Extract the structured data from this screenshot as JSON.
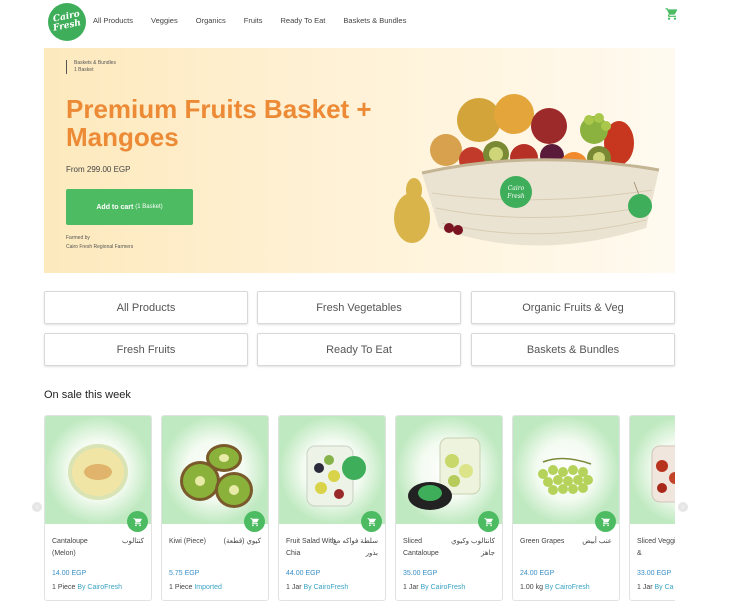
{
  "header": {
    "logo_line1": "Cairo",
    "logo_line2": "Fresh",
    "nav": [
      "All Products",
      "Veggies",
      "Organics",
      "Fruits",
      "Ready To Eat",
      "Baskets & Bundles"
    ]
  },
  "hero": {
    "breadcrumb_category": "Baskets & Bundles",
    "breadcrumb_count": "1 Basket",
    "title": "Premium Fruits Basket + Mangoes",
    "price_from": "From 299.00 EGP",
    "add_to_cart": "Add to cart",
    "add_to_cart_qty": "(1 Basket)",
    "farmed_by_label": "Farmed by",
    "farmed_by_value": "Cairo Fresh Regional Farmers",
    "tag_text": "Cairo Fresh"
  },
  "categories": [
    "All Products",
    "Fresh Vegetables",
    "Organic Fruits & Veg",
    "Fresh Fruits",
    "Ready To Eat",
    "Baskets & Bundles"
  ],
  "sale_section_title": "On sale this week",
  "products": [
    {
      "name_en": "Cantaloupe (Melon)",
      "name_ar": "كنتالوب",
      "price": "14.00 EGP",
      "unit": "1 Piece",
      "source": "By CairoFresh"
    },
    {
      "name_en": "Kiwi (Piece)",
      "name_ar": "كيوي (قطعة)",
      "price": "5.75 EGP",
      "unit": "1 Piece",
      "source": "Imported"
    },
    {
      "name_en": "Fruit Salad With Chia",
      "name_ar": "سلطة فواكه مع بذور",
      "price": "44.00 EGP",
      "unit": "1 Jar",
      "source": "By CairoFresh"
    },
    {
      "name_en": "Sliced Cantaloupe",
      "name_ar": "كانتالوب وكيوي جاهز",
      "price": "35.00 EGP",
      "unit": "1 Jar",
      "source": "By CairoFresh"
    },
    {
      "name_en": "Green Grapes",
      "name_ar": "عنب أبيض",
      "price": "24.00 EGP",
      "unit": "1.00 kg",
      "source": "By CairoFresh"
    },
    {
      "name_en": "Sliced Veggies &",
      "name_ar": "",
      "price": "33.00 EGP",
      "unit": "1 Jar",
      "source": "By Ca"
    }
  ],
  "colors": {
    "brand_green": "#4cbb62",
    "title_orange": "#ec8a36",
    "price_blue": "#3a8fc6"
  }
}
